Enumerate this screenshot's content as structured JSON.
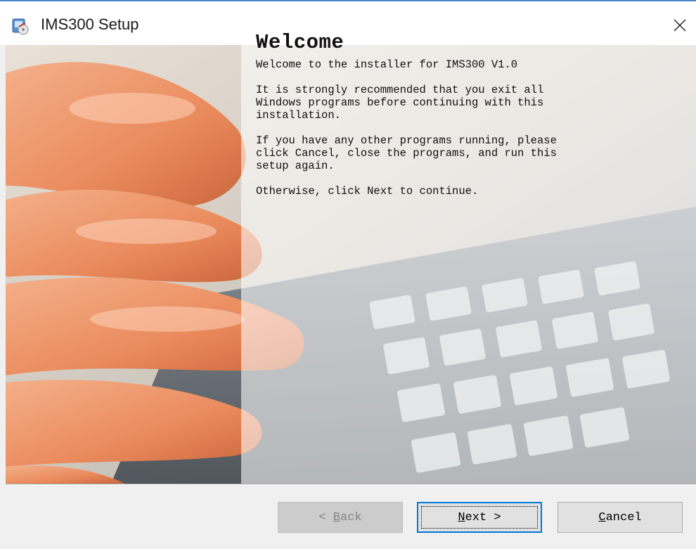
{
  "window": {
    "title": "IMS300 Setup",
    "close_glyph": "✕"
  },
  "page": {
    "heading": "Welcome",
    "subtitle": "Welcome to the installer for IMS300 V1.0",
    "para1": "It is strongly recommended that you exit all\nWindows programs before continuing with this\ninstallation.",
    "para2": "If you have any other programs running, please\nclick Cancel, close the programs, and run this\nsetup again.",
    "para3": "Otherwise, click Next to continue."
  },
  "buttons": {
    "back": {
      "prefix": "< ",
      "accel": "B",
      "rest": "ack",
      "enabled": false
    },
    "next": {
      "accel": "N",
      "rest": "ext >",
      "default": true
    },
    "cancel": {
      "accel": "C",
      "rest": "ancel"
    }
  },
  "icons": {
    "app": "installer-app-icon",
    "close": "close-icon"
  },
  "colors": {
    "accent": "#0078d7",
    "title_bg": "#ffffff",
    "dialog_bg": "#f0f0f0"
  }
}
